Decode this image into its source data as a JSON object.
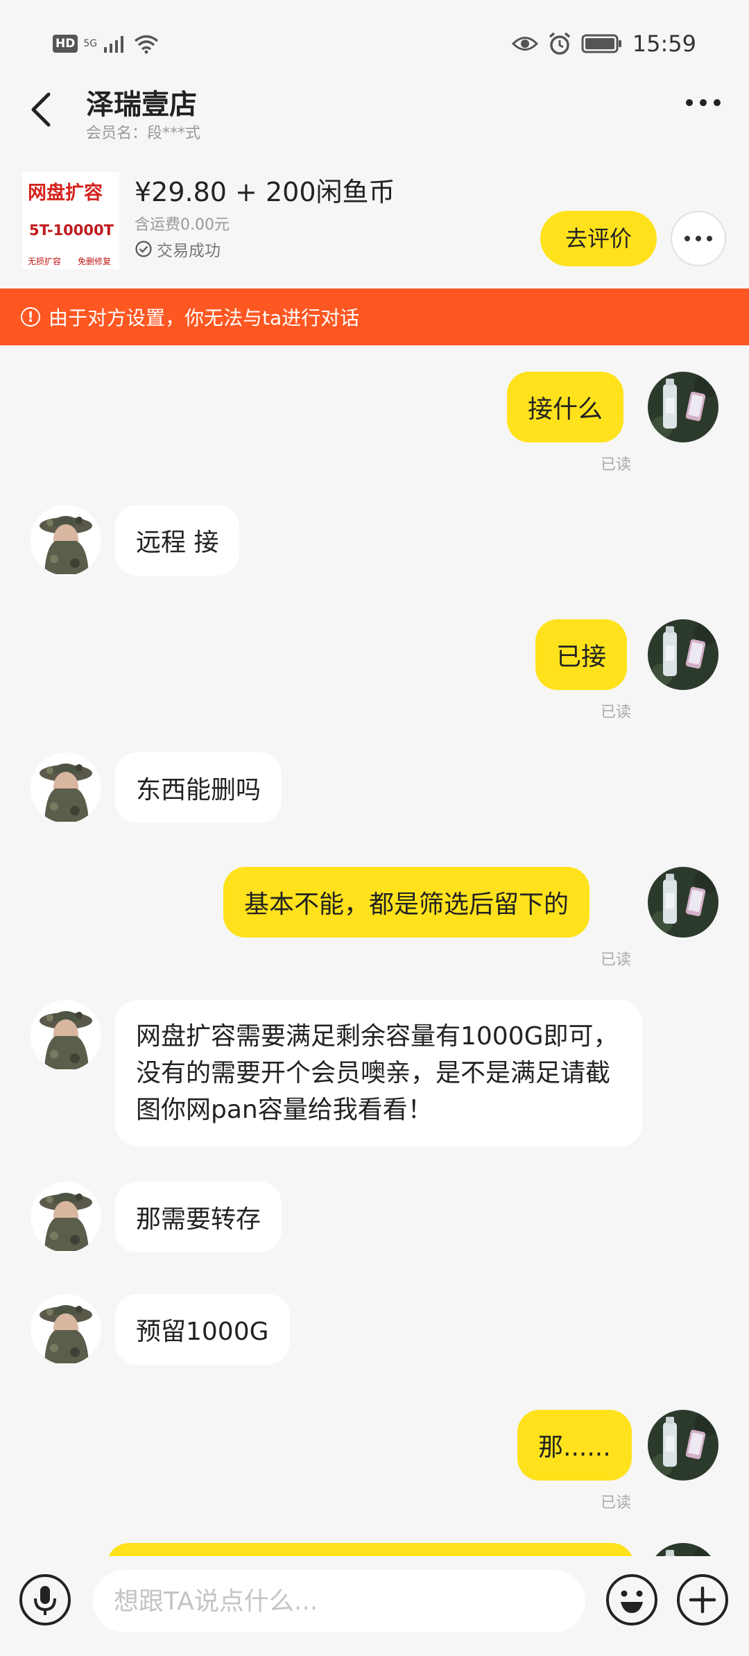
{
  "status_bar": {
    "hd": "HD",
    "network": "5G",
    "time": "15:59"
  },
  "header": {
    "title": "泽瑞壹店",
    "subtitle": "会员名：段***式"
  },
  "product": {
    "thumb_line1": "网盘扩容",
    "thumb_line2": "5T-10000T",
    "thumb_line3": "无损扩容",
    "thumb_line4": "免删修复",
    "price": "¥29.80 + 200闲鱼币",
    "freight": "含运费0.00元",
    "status": "交易成功",
    "review_label": "去评价"
  },
  "banner": {
    "text": "由于对方设置，你无法与ta进行对话"
  },
  "messages": [
    {
      "from": "me",
      "text": "接什么",
      "status": "已读"
    },
    {
      "from": "them",
      "text": "远程 接"
    },
    {
      "from": "me",
      "text": "已接",
      "status": "已读"
    },
    {
      "from": "them",
      "text": "东西能删吗"
    },
    {
      "from": "me",
      "text": "基本不能，都是筛选后留下的",
      "status": "已读"
    },
    {
      "from": "them",
      "text": "网盘扩容需要满足剩余容量有1000G即可，没有的需要开个会员噢亲，是不是满足请截图你网pan容量给我看看！"
    },
    {
      "from": "them",
      "text": "那需要转存"
    },
    {
      "from": "them",
      "text": "预留1000G"
    },
    {
      "from": "me",
      "text": "那......",
      "status": "已读"
    },
    {
      "from": "me",
      "text": ""
    }
  ],
  "input": {
    "placeholder": "想跟TA说点什么..."
  },
  "colors": {
    "accent": "#ffe21c",
    "banner": "#ff5722",
    "background": "#f6f6f6"
  },
  "icons": [
    "back-icon",
    "more-icon",
    "check-circle-icon",
    "warning-icon",
    "microphone-icon",
    "emoji-icon",
    "plus-icon"
  ]
}
